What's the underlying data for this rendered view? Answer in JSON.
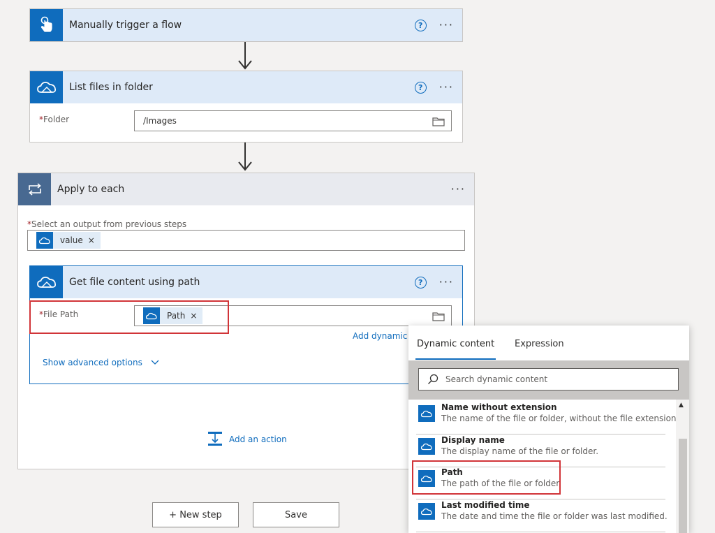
{
  "trigger": {
    "title": "Manually trigger a flow",
    "help": "?",
    "more": "···"
  },
  "list_files": {
    "title": "List files in folder",
    "help": "?",
    "more": "···",
    "folder_label": "Folder",
    "folder_value": "/Images",
    "required": "*"
  },
  "apply_each": {
    "title": "Apply to each",
    "more": "···",
    "select_label": "Select an output from previous steps",
    "required": "*",
    "token_label": "value",
    "token_remove": "×"
  },
  "get_file": {
    "title": "Get file content using path",
    "help": "?",
    "more": "···",
    "path_label": "File Path",
    "required": "*",
    "token_label": "Path",
    "token_remove": "×",
    "add_dynamic": "Add dynamic",
    "show_advanced": "Show advanced options"
  },
  "add_action": {
    "label": "Add an action"
  },
  "buttons": {
    "new_step": "+ New step",
    "save": "Save"
  },
  "dynamic_panel": {
    "tab_dynamic": "Dynamic content",
    "tab_expression": "Expression",
    "search_placeholder": "Search dynamic content",
    "items": [
      {
        "name": "Name without extension",
        "desc": "The name of the file or folder, without the file extension."
      },
      {
        "name": "Display name",
        "desc": "The display name of the file or folder."
      },
      {
        "name": "Path",
        "desc": "The path of the file or folder."
      },
      {
        "name": "Last modified time",
        "desc": "The date and time the file or folder was last modified."
      }
    ]
  },
  "colors": {
    "accent": "#0f6cbd",
    "header_bg": "#deeaf8",
    "apply_icon_bg": "#486991",
    "highlight": "#d13438"
  }
}
